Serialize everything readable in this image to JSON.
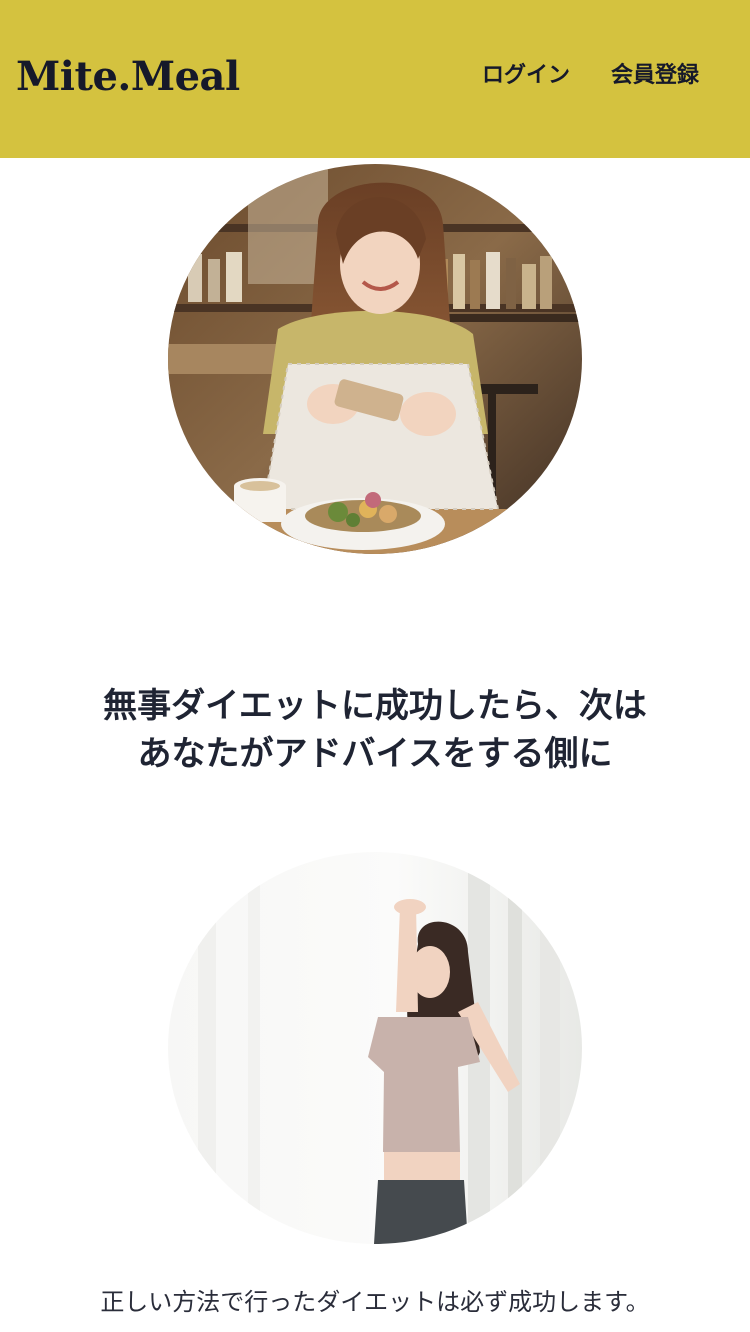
{
  "header": {
    "logo": "Mite.Meal",
    "nav": {
      "login": "ログイン",
      "signup": "会員登録"
    },
    "bg_color": "#d4c23f"
  },
  "hero_image": {
    "subject": "woman-photographing-meal-in-cafe"
  },
  "headline": {
    "line1": "無事ダイエットに成功したら、次は",
    "line2": "あなたがアドバイスをする側に"
  },
  "second_image": {
    "subject": "woman-stretching-in-bright-room"
  },
  "body": {
    "text": "正しい方法で行ったダイエットは必ず成功します。"
  }
}
